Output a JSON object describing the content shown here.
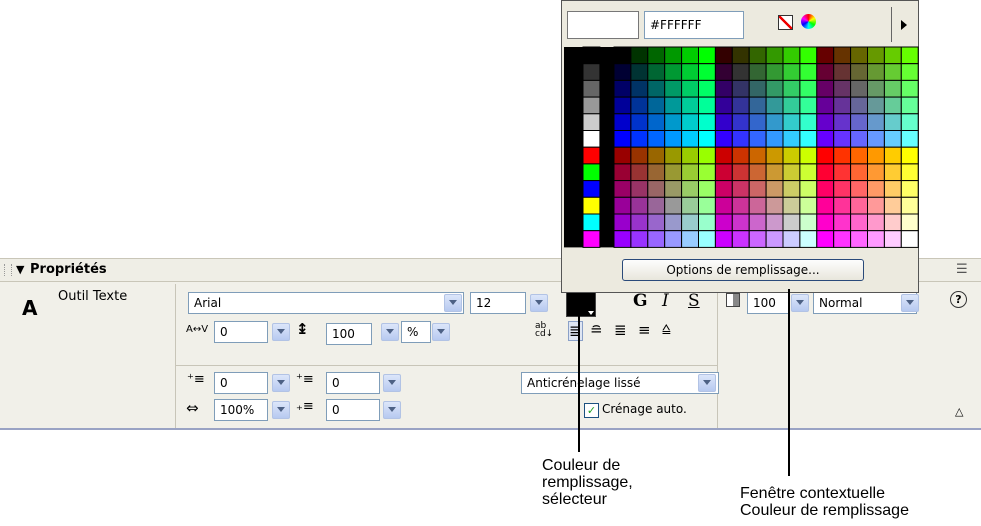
{
  "panel": {
    "title": "Propriétés",
    "tool_label": "Outil Texte",
    "font_name": "Arial",
    "font_size": "12",
    "tracking": "0",
    "line_height": "100",
    "line_height_unit": "%",
    "indent_left": "0",
    "indent_first": "0",
    "text_scale": "100%",
    "line_spacing_after": "0",
    "antialias": "Anticrénelage lissé",
    "auto_kerning_label": "Crénage auto.",
    "auto_kerning_checked": true,
    "bold_label": "G",
    "italic_label": "I",
    "underline_label": "S",
    "alpha": "100",
    "blend_mode": "Normal",
    "help_icon": "help-icon",
    "fill_color": "#000000"
  },
  "popup": {
    "hex_value": "#FFFFFF",
    "options_button": "Options de remplissage..."
  },
  "callouts": {
    "fill_selector": [
      "Couleur de",
      "remplissage,",
      "sélecteur"
    ],
    "popup_window": [
      "Fenêtre contextuelle",
      "Couleur de remplissage"
    ]
  }
}
